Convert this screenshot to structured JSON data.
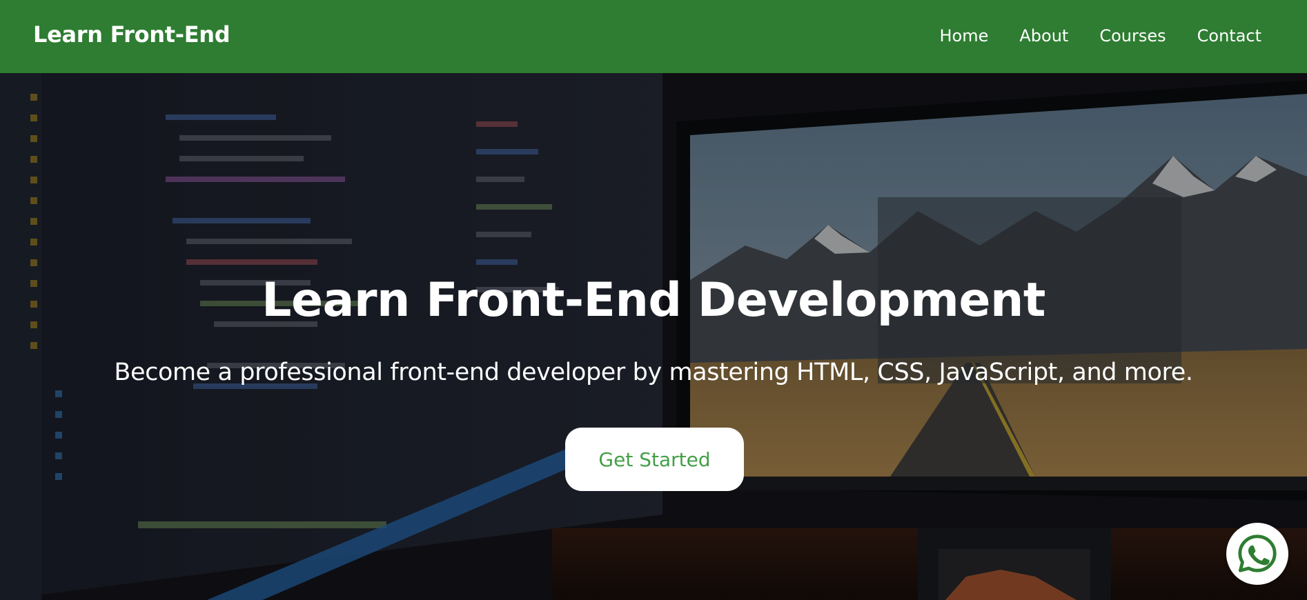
{
  "navbar": {
    "brand": "Learn Front-End",
    "background_color": "#2e7d32",
    "links": [
      {
        "label": "Home"
      },
      {
        "label": "About"
      },
      {
        "label": "Courses"
      },
      {
        "label": "Contact"
      }
    ]
  },
  "hero": {
    "title": "Learn Front-End Development",
    "subtitle": "Become a professional front-end developer by mastering HTML, CSS, JavaScript, and more.",
    "cta_label": "Get Started",
    "cta_text_color": "#43a047",
    "background_image": "desk-monitors-code-editor-mountain-wallpaper"
  },
  "floating": {
    "whatsapp_icon": "whatsapp-icon",
    "whatsapp_color": "#2e7d32"
  }
}
